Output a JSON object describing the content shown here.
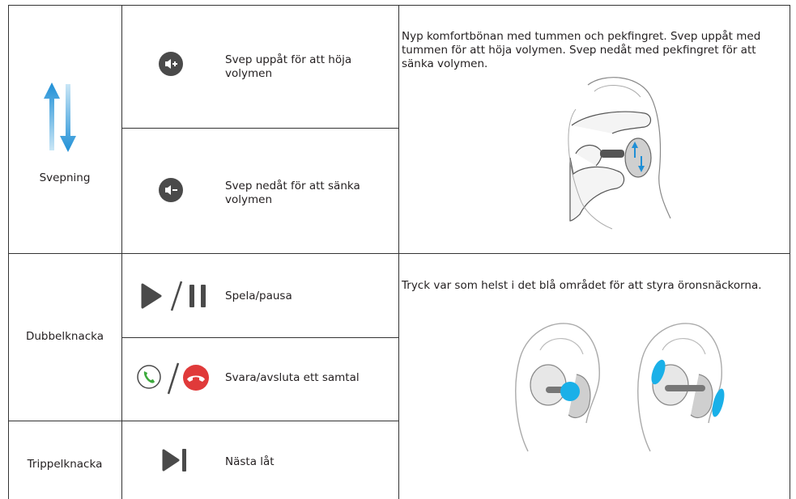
{
  "rows": {
    "swipe": {
      "label": "Svepning",
      "actions": [
        {
          "text": "Svep uppåt för att höja volymen",
          "icon": "volume-up-icon"
        },
        {
          "text": "Svep nedåt för att sänka volymen",
          "icon": "volume-down-icon"
        }
      ],
      "description": "Nyp komfortbönan med tummen och pekfingret. Svep uppåt med tummen för att höja volymen. Svep nedåt med pekfingret för att sänka volymen."
    },
    "double_tap": {
      "label": "Dubbelknacka",
      "actions": [
        {
          "text": "Spela/pausa",
          "icon": "play-pause-icon"
        },
        {
          "text": "Svara/avsluta ett samtal",
          "icon": "answer-end-call-icon"
        }
      ],
      "description": "Tryck var som helst i det blå området för att styra öronsnäckorna."
    },
    "triple_tap": {
      "label": "Trippelknacka",
      "actions": [
        {
          "text": "Nästa låt",
          "icon": "next-track-icon"
        }
      ]
    }
  },
  "colors": {
    "border": "#333333",
    "icon_gray": "#4a4a4a",
    "tap_blue": "#1ab0e8",
    "call_green": "#3daa3d",
    "call_red": "#e03a3a"
  }
}
